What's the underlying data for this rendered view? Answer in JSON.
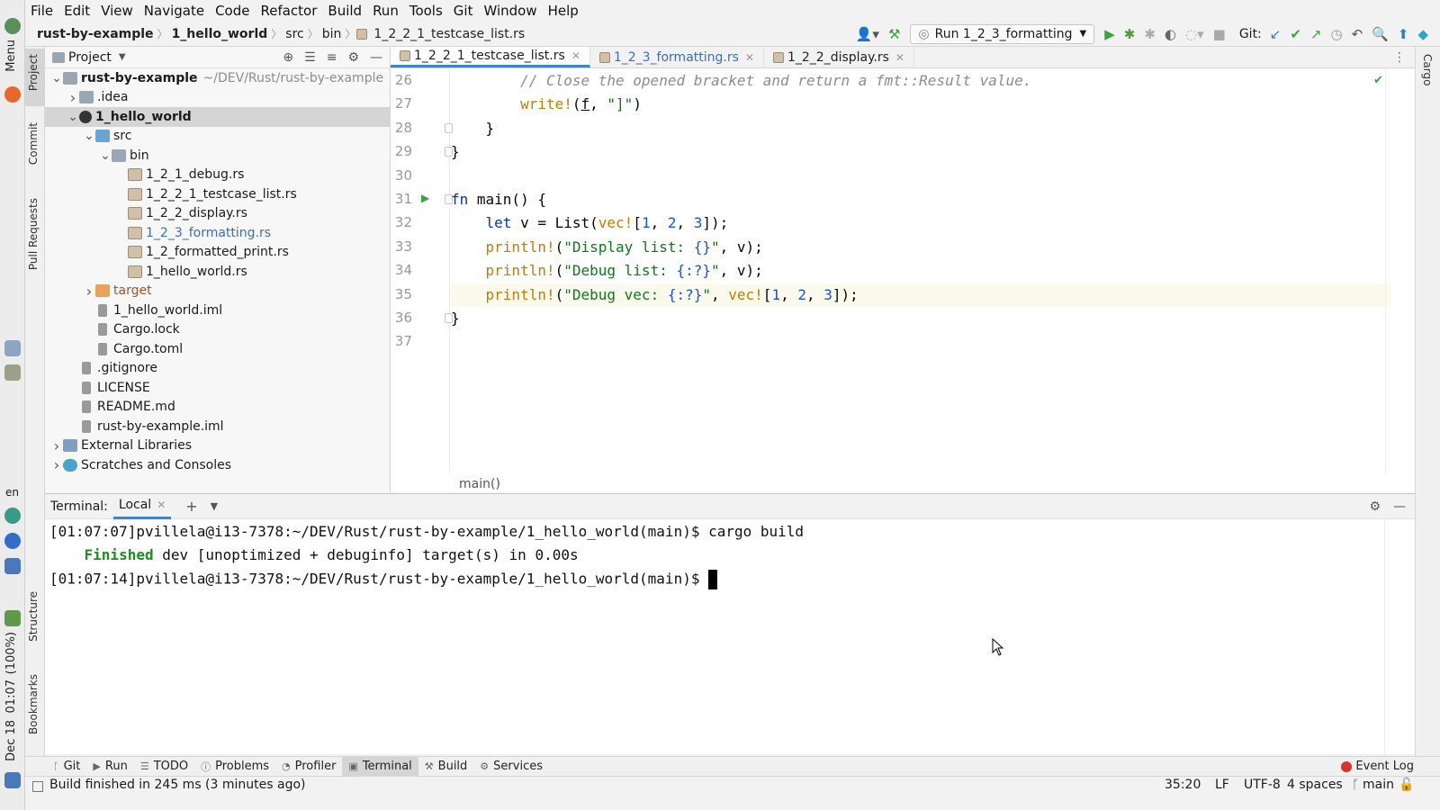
{
  "os_bar": {
    "menu_label": "Menu",
    "lang": "en",
    "battery": "(100%)",
    "time": "01:07",
    "date": "Dec 18"
  },
  "menu": [
    "File",
    "Edit",
    "View",
    "Navigate",
    "Code",
    "Refactor",
    "Build",
    "Run",
    "Tools",
    "Git",
    "Window",
    "Help"
  ],
  "breadcrumbs": [
    "rust-by-example",
    "1_hello_world",
    "src",
    "bin",
    "1_2_2_1_testcase_list.rs"
  ],
  "run_config": "Run 1_2_3_formatting",
  "git_label": "Git:",
  "left_tabs": {
    "project": "Project",
    "commit": "Commit",
    "pull_requests": "Pull Requests",
    "structure": "Structure",
    "bookmarks": "Bookmarks"
  },
  "right_tabs": {
    "cargo": "Cargo"
  },
  "project_panel": {
    "title": "Project",
    "tree": [
      {
        "label": "rust-by-example",
        "hint": "~/DEV/Rust/rust-by-example",
        "level": 0,
        "expanded": true,
        "type": "module",
        "bold": true
      },
      {
        "label": ".idea",
        "level": 1,
        "expanded": false,
        "type": "folder"
      },
      {
        "label": "1_hello_world",
        "level": 1,
        "expanded": true,
        "type": "crate",
        "bold": true,
        "selected": true
      },
      {
        "label": "src",
        "level": 2,
        "expanded": true,
        "type": "folder-src"
      },
      {
        "label": "bin",
        "level": 3,
        "expanded": true,
        "type": "folder"
      },
      {
        "label": "1_2_1_debug.rs",
        "level": 4,
        "type": "rs"
      },
      {
        "label": "1_2_2_1_testcase_list.rs",
        "level": 4,
        "type": "rs"
      },
      {
        "label": "1_2_2_display.rs",
        "level": 4,
        "type": "rs"
      },
      {
        "label": "1_2_3_formatting.rs",
        "level": 4,
        "type": "rs",
        "modified": true
      },
      {
        "label": "1_2_formatted_print.rs",
        "level": 4,
        "type": "rs"
      },
      {
        "label": "1_hello_world.rs",
        "level": 4,
        "type": "rs"
      },
      {
        "label": "target",
        "level": 2,
        "expanded": false,
        "type": "folder-excluded",
        "color": "#a0522d"
      },
      {
        "label": "1_hello_world.iml",
        "level": 2,
        "type": "file"
      },
      {
        "label": "Cargo.lock",
        "level": 2,
        "type": "file"
      },
      {
        "label": "Cargo.toml",
        "level": 2,
        "type": "file"
      },
      {
        "label": ".gitignore",
        "level": 1,
        "type": "file"
      },
      {
        "label": "LICENSE",
        "level": 1,
        "type": "file"
      },
      {
        "label": "README.md",
        "level": 1,
        "type": "file"
      },
      {
        "label": "rust-by-example.iml",
        "level": 1,
        "type": "file"
      },
      {
        "label": "External Libraries",
        "level": 0,
        "expanded": false,
        "type": "libs"
      },
      {
        "label": "Scratches and Consoles",
        "level": 0,
        "expanded": false,
        "type": "scratches"
      }
    ]
  },
  "editor": {
    "tabs": [
      {
        "label": "1_2_2_1_testcase_list.rs",
        "active": true
      },
      {
        "label": "1_2_3_formatting.rs",
        "modified": true
      },
      {
        "label": "1_2_2_display.rs"
      }
    ],
    "lines": [
      {
        "n": "26",
        "html": "        <span class=\"com\">// Close the opened bracket and return a fmt::Result value.</span>"
      },
      {
        "n": "27",
        "html": "        <span class=\"mac\">write!</span>(<u>f</u>, <span class=\"str\">\"]\"</span>)"
      },
      {
        "n": "28",
        "html": "    }"
      },
      {
        "n": "29",
        "html": "}"
      },
      {
        "n": "30",
        "html": ""
      },
      {
        "n": "31",
        "html": "<span class=\"kw\">fn</span> main() {"
      },
      {
        "n": "32",
        "html": "    <span class=\"kw\">let</span> v = List(<span class=\"mac\">vec!</span>[<span class=\"num\">1</span>, <span class=\"num\">2</span>, <span class=\"num\">3</span>]);"
      },
      {
        "n": "33",
        "html": "    <span class=\"mac\">println!</span>(<span class=\"str\">\"Display list: </span><span class=\"num\">{}</span><span class=\"str\">\"</span>, v);"
      },
      {
        "n": "34",
        "html": "    <span class=\"mac\">println!</span>(<span class=\"str\">\"Debug list: </span><span class=\"num\">{:?}</span><span class=\"str\">\"</span>, v);"
      },
      {
        "n": "35",
        "html": "    <span class=\"mac\">println!</span>(<span class=\"str\">\"Debug vec: </span><span class=\"num\">{:?}</span><span class=\"str\">\"</span>, <span class=\"mac\">vec!</span>[<span class=\"num\">1</span>, <span class=\"num\">2</span>, <span class=\"num\">3</span>]);",
        "current": true
      },
      {
        "n": "36",
        "html": "}"
      },
      {
        "n": "37",
        "html": ""
      }
    ],
    "breadcrumb": "main()"
  },
  "terminal": {
    "label": "Terminal:",
    "tab": "Local",
    "lines": [
      {
        "prompt": "[01:07:07]pvillela@i13-7378:~/DEV/Rust/rust-by-example/1_hello_world(main)$ ",
        "cmd": "cargo build"
      },
      {
        "green": "    Finished",
        "rest": " dev [unoptimized + debuginfo] target(s) in 0.00s"
      },
      {
        "prompt": "[01:07:14]pvillela@i13-7378:~/DEV/Rust/rust-by-example/1_hello_world(main)$ ",
        "cursor": true
      }
    ]
  },
  "bottom_tools": [
    {
      "label": "Git",
      "icon": "git-icon"
    },
    {
      "label": "Run",
      "icon": "run-icon"
    },
    {
      "label": "TODO",
      "icon": "todo-icon"
    },
    {
      "label": "Problems",
      "icon": "problems-icon"
    },
    {
      "label": "Profiler",
      "icon": "profiler-icon"
    },
    {
      "label": "Terminal",
      "icon": "terminal-icon",
      "active": true
    },
    {
      "label": "Build",
      "icon": "build-icon"
    },
    {
      "label": "Services",
      "icon": "services-icon"
    }
  ],
  "event_log": "Event Log",
  "status": {
    "message": "Build finished in 245 ms (3 minutes ago)",
    "position": "35:20",
    "line_sep": "LF",
    "encoding": "UTF-8",
    "indent": "4 spaces",
    "branch": "main"
  },
  "colors": {
    "accent": "#4083c9",
    "run_green": "#3ba33b",
    "terminal_green": "#1a8f1a"
  }
}
